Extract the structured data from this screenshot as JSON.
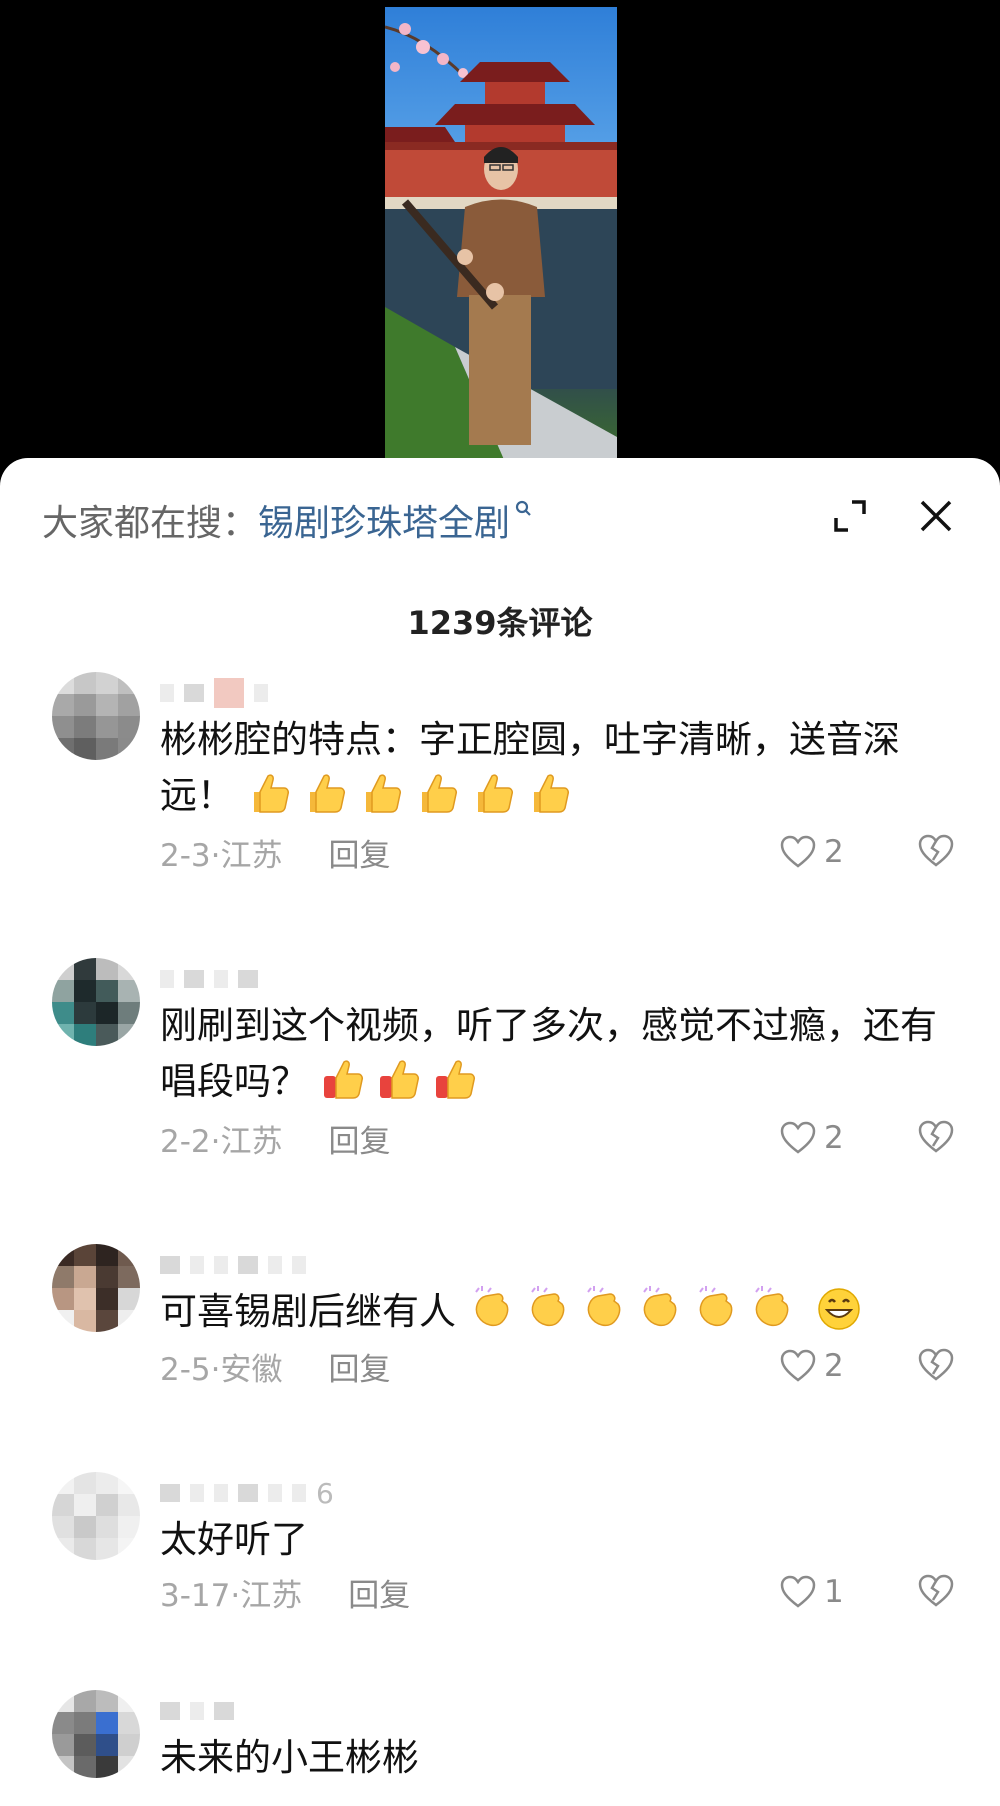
{
  "search": {
    "prefix": "大家都在搜：",
    "term": "锡剧珍珠塔全剧"
  },
  "comments_header": "1239条评论",
  "comments": [
    {
      "text": "彬彬腔的特点：字正腔圆，吐字清晰，送音深远！",
      "emoji": "thumbs-up",
      "emoji_count": 6,
      "date_location": "2-3·江苏",
      "reply_label": "回复",
      "likes": "2"
    },
    {
      "text": "刚刷到这个视频，听了多次，感觉不过瘾，还有唱段吗？",
      "emoji": "thumbs-up",
      "emoji_count": 3,
      "date_location": "2-2·江苏",
      "reply_label": "回复",
      "likes": "2"
    },
    {
      "text": "可喜锡剧后继有人",
      "emoji": "clapping-hands",
      "emoji_count": 6,
      "extra_emoji": "grinning-face",
      "date_location": "2-5·安徽",
      "reply_label": "回复",
      "likes": "2"
    },
    {
      "text": "太好听了",
      "username_fragment": "6",
      "date_location": "3-17·江苏",
      "reply_label": "回复",
      "likes": "1"
    },
    {
      "text": "未来的小王彬彬"
    }
  ],
  "colors": {
    "search_term": "#3a6592",
    "meta_text": "#a6a6a6",
    "sheet_background": "#ffffff"
  }
}
